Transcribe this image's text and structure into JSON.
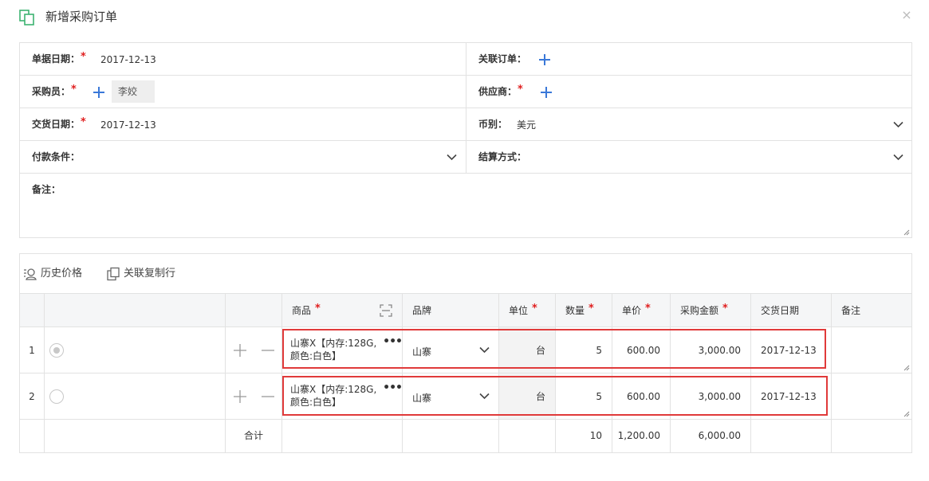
{
  "dialog": {
    "title": "新增采购订单",
    "close_icon": "×"
  },
  "form": {
    "doc_date_label": "单据日期：",
    "doc_date_value": "2017-12-13",
    "related_order_label": "关联订单：",
    "buyer_label": "采购员：",
    "buyer_value": "李姣",
    "supplier_label": "供应商：",
    "delivery_date_label": "交货日期：",
    "delivery_date_value": "2017-12-13",
    "currency_label": "币别：",
    "currency_value": "美元",
    "payment_terms_label": "付款条件：",
    "settlement_label": "结算方式：",
    "remarks_label": "备注：",
    "required_mark": "*"
  },
  "toolbar": {
    "history_price": "历史价格",
    "copy_row": "关联复制行"
  },
  "table": {
    "headers": {
      "product": "商品",
      "brand": "品牌",
      "unit": "单位",
      "quantity": "数量",
      "unit_price": "单价",
      "amount": "采购金额",
      "delivery_date": "交货日期",
      "remarks": "备注"
    },
    "rows": [
      {
        "index": "1",
        "product": "山寨X【内存:128G,颜色:白色】",
        "brand": "山寨",
        "unit": "台",
        "quantity": "5",
        "unit_price": "600.00",
        "amount": "3,000.00",
        "delivery_date": "2017-12-13",
        "selected": true
      },
      {
        "index": "2",
        "product": "山寨X【内存:128G,颜色:白色】",
        "brand": "山寨",
        "unit": "台",
        "quantity": "5",
        "unit_price": "600.00",
        "amount": "3,000.00",
        "delivery_date": "2017-12-13",
        "selected": false
      }
    ],
    "total": {
      "label": "合计",
      "quantity": "10",
      "unit_price": "1,200.00",
      "amount": "6,000.00"
    },
    "more_icon": "•••"
  },
  "colors": {
    "accent_blue": "#3a78d8",
    "required_red": "#e02020",
    "highlight_red": "#e03a3a",
    "brand_green": "#3cb371"
  }
}
